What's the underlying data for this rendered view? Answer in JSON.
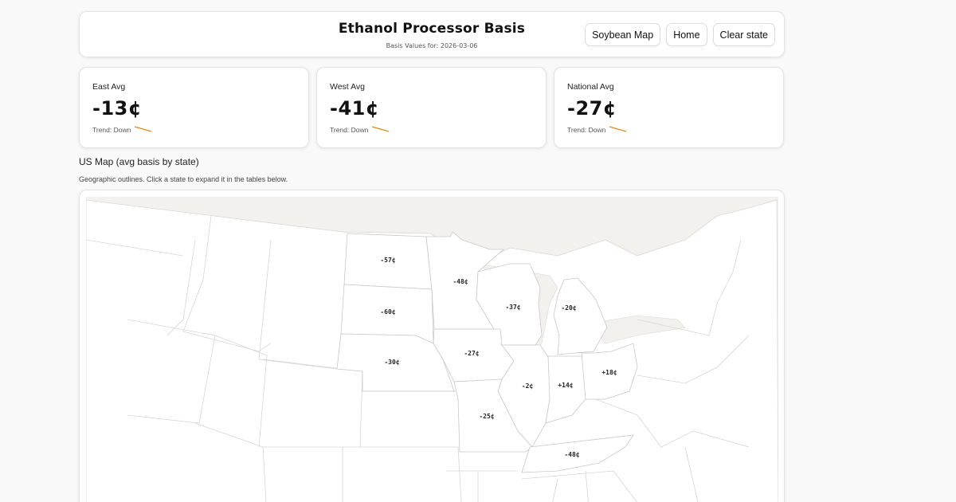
{
  "header": {
    "title": "Ethanol Processor Basis",
    "subtitle": "Basis Values for: 2026-03-06",
    "buttons": [
      "Soybean Map",
      "Home",
      "Clear state"
    ]
  },
  "stats": [
    {
      "label": "East Avg",
      "value": "-13¢",
      "trend": "Trend: Down"
    },
    {
      "label": "West Avg",
      "value": "-41¢",
      "trend": "Trend: Down"
    },
    {
      "label": "National Avg",
      "value": "-27¢",
      "trend": "Trend: Down"
    }
  ],
  "map": {
    "title": "US Map (avg basis by state)",
    "subtitle": "Geographic outlines. Click a state to expand it in the tables below.",
    "states": [
      {
        "name": "North Dakota",
        "label": "-57¢",
        "color": "#d7ad8c"
      },
      {
        "name": "South Dakota",
        "label": "-60¢",
        "color": "#d9a98b"
      },
      {
        "name": "Minnesota",
        "label": "-48¢",
        "color": "#d8b38f"
      },
      {
        "name": "Wisconsin",
        "label": "-37¢",
        "color": "#d8c295"
      },
      {
        "name": "Michigan",
        "label": "-20¢",
        "color": "#d7d896"
      },
      {
        "name": "Nebraska",
        "label": "-30¢",
        "color": "#d8cf93"
      },
      {
        "name": "Iowa",
        "label": "-27¢",
        "color": "#d8d092"
      },
      {
        "name": "Illinois",
        "label": "-2¢",
        "color": "#c7e19a"
      },
      {
        "name": "Indiana",
        "label": "+14¢",
        "color": "#a8d88a"
      },
      {
        "name": "Ohio",
        "label": "+18¢",
        "color": "#9dd480"
      },
      {
        "name": "Missouri",
        "label": "-25¢",
        "color": "#d9d594"
      },
      {
        "name": "Tennessee",
        "label": "-48¢",
        "color": "#d8b58f"
      }
    ]
  }
}
